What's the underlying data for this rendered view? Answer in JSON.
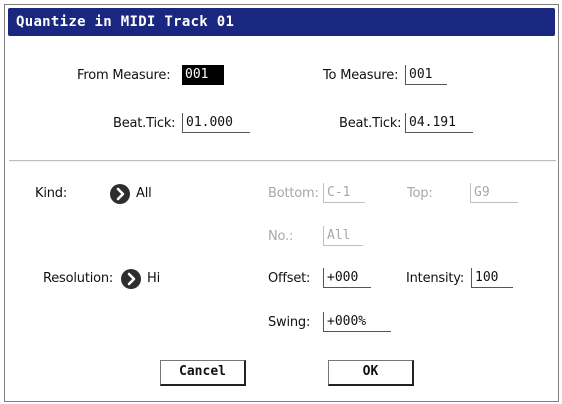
{
  "dialog": {
    "title": "Quantize in MIDI Track 01"
  },
  "range": {
    "from_measure_label": "From Measure:",
    "from_measure_value": "001",
    "to_measure_label": "To Measure:",
    "to_measure_value": "001",
    "from_beat_label": "Beat.Tick:",
    "from_beat_value": "01.000",
    "to_beat_label": "Beat.Tick:",
    "to_beat_value": "04.191"
  },
  "options": {
    "kind_label": "Kind:",
    "kind_value": "All",
    "bottom_label": "Bottom:",
    "bottom_value": "C-1",
    "top_label": "Top:",
    "top_value": "G9",
    "no_label": "No.:",
    "no_value": "All",
    "resolution_label": "Resolution:",
    "resolution_value": "Hi",
    "offset_label": "Offset:",
    "offset_value": "+000",
    "intensity_label": "Intensity:",
    "intensity_value": "100",
    "swing_label": "Swing:",
    "swing_value": "+000%"
  },
  "buttons": {
    "cancel": "Cancel",
    "ok": "OK"
  },
  "colors": {
    "title_bar": "#1a2780",
    "selected_field": "#000000",
    "disabled_text": "#a8a8a8"
  },
  "icons": {
    "popup": "chevron-right-circle-icon"
  }
}
